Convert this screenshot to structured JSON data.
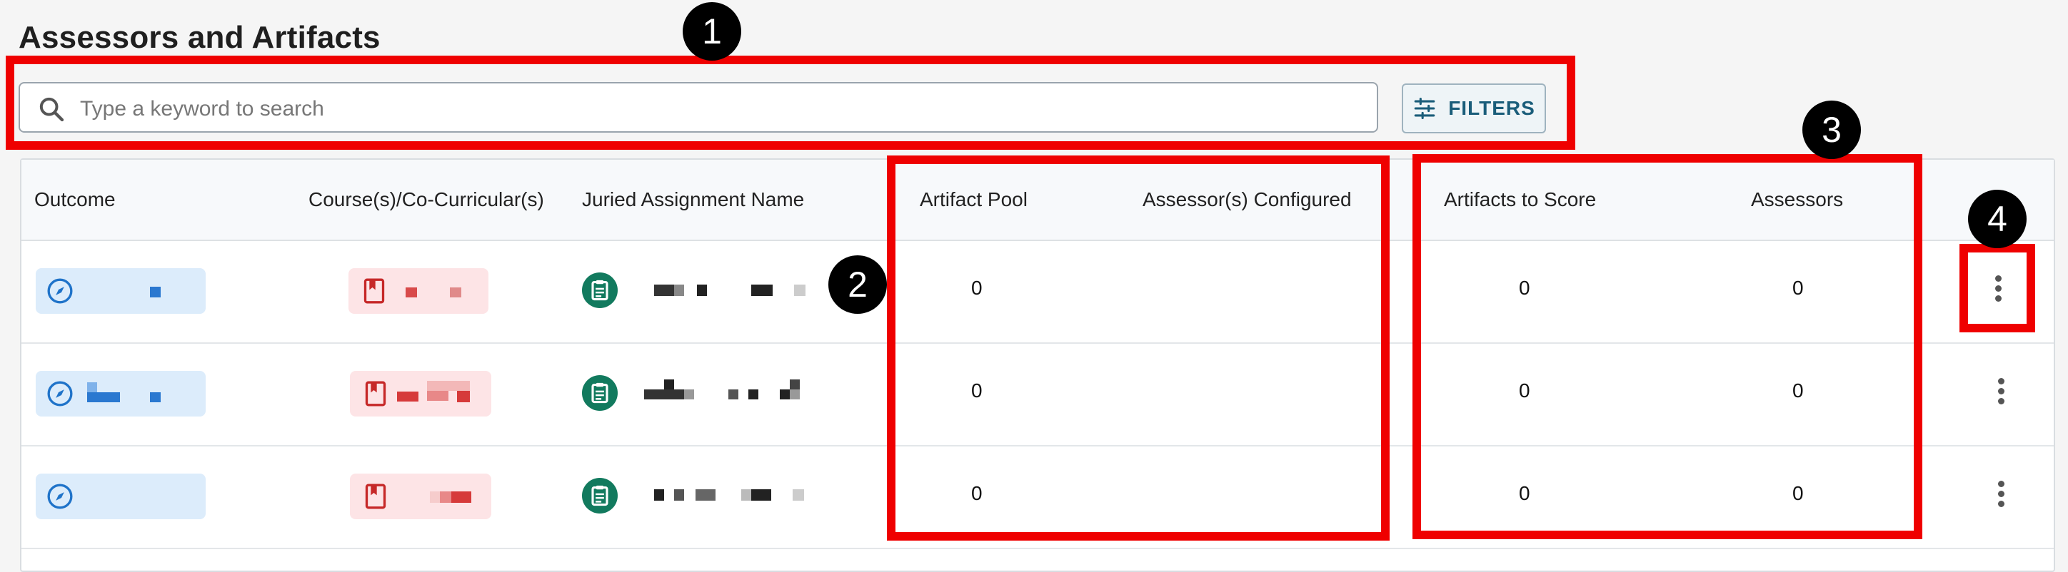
{
  "page": {
    "title": "Assessors and Artifacts"
  },
  "search": {
    "placeholder": "Type a keyword to search",
    "value": ""
  },
  "filters": {
    "label": "FILTERS"
  },
  "table": {
    "headers": {
      "outcome": "Outcome",
      "courses": "Course(s)/Co-Curricular(s)",
      "assignment": "Juried Assignment Name",
      "artifact_pool": "Artifact Pool",
      "assessors_configured": "Assessor(s) Configured",
      "artifacts_to_score": "Artifacts to Score",
      "assessors": "Assessors"
    },
    "rows": [
      {
        "artifact_pool": "0",
        "assessors_configured": "",
        "artifacts_to_score": "0",
        "assessors": "0"
      },
      {
        "artifact_pool": "0",
        "assessors_configured": "",
        "artifacts_to_score": "0",
        "assessors": "0"
      },
      {
        "artifact_pool": "0",
        "assessors_configured": "",
        "artifacts_to_score": "0",
        "assessors": "0"
      }
    ]
  },
  "annotations": {
    "badge_1": "1",
    "badge_2": "2",
    "badge_3": "3",
    "badge_4": "4",
    "highlight_color": "#ef0000"
  },
  "icons": {
    "search": "search-icon",
    "filters": "sliders-icon",
    "outcome": "compass-icon",
    "course": "bookmark-book-icon",
    "assignment": "clipboard-icon",
    "row_menu": "more-vertical-icon"
  },
  "colors": {
    "accent": "#1a5d7a",
    "outcome_chip": "#dcecfb",
    "outcome_icon": "#1f73c9",
    "course_chip": "#fde4e6",
    "course_icon": "#c62828",
    "assignment_icon_bg": "#127a5e"
  }
}
